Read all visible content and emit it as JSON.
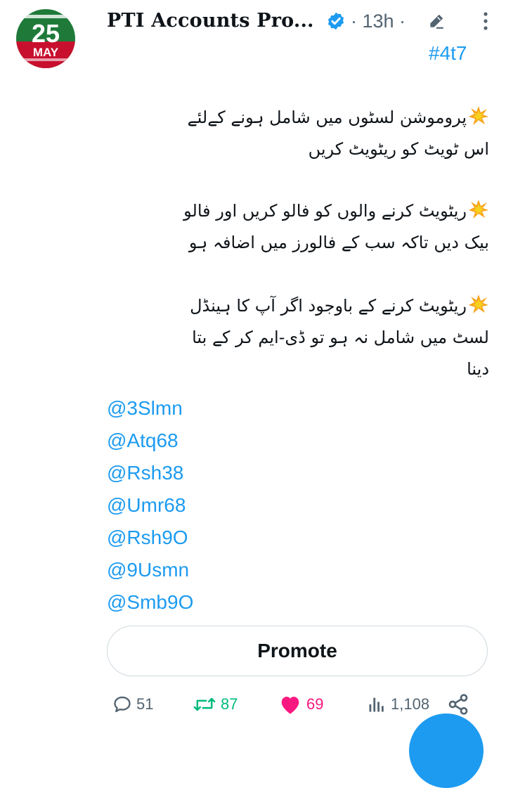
{
  "author": {
    "display_name": "PTI Accounts Pro...",
    "time": "· 13h ·",
    "avatar_text": "25",
    "avatar_subtext": "MAY"
  },
  "tweet": {
    "hashtag": "#4t7",
    "paragraphs": [
      [
        "پروموشن لسٹوں میں شامل ہونے کےلئے",
        "اس ٹویٹ کو ریٹویٹ کریں"
      ],
      [
        "ریٹویٹ کرنے والوں کو فالو کریں اور فالو",
        "بیک دیں تاکہ سب کے فالورز میں اضافہ ہو"
      ],
      [
        "ریٹویٹ کرنے کے باوجود اگر آپ کا ہینڈل",
        "لسٹ میں شامل نہ ہو تو ڈی-ایم کر کے بتا",
        "دینا"
      ]
    ],
    "mentions": [
      "@3Slmn",
      "@Atq68",
      "@Rsh38",
      "@Umr68",
      "@Rsh9O",
      "@9Usmn",
      "@Smb9O"
    ]
  },
  "promote_label": "Promote",
  "stats": {
    "replies": "51",
    "retweets": "87",
    "likes": "69",
    "views": "1,108"
  },
  "colors": {
    "link": "#1d9bf0",
    "retweet": "#00ba7c",
    "like": "#f91880",
    "muted": "#536471",
    "avatar_green": "#1f7a3a",
    "avatar_red": "#c8102e"
  }
}
